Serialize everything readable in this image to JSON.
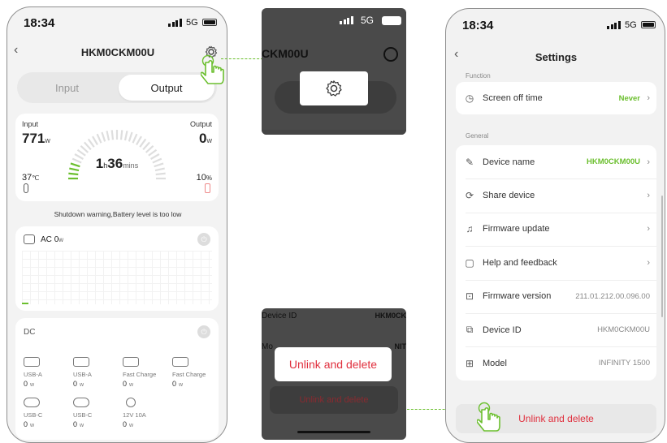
{
  "colors": {
    "accent_green": "#6bbf2e",
    "danger_red": "#e0303e",
    "zoom_bg": "#4a4a4a"
  },
  "phone1": {
    "status": {
      "time": "18:34",
      "network": "5G"
    },
    "header": {
      "title": "HKM0CKM00U",
      "back_icon": "chevron-left-icon",
      "settings_icon": "gear-icon"
    },
    "tabs": {
      "input": "Input",
      "output": "Output"
    },
    "gauge": {
      "input_label": "Input",
      "input_value": "771",
      "input_unit": "w",
      "output_label": "Output",
      "output_value": "0",
      "output_unit": "w",
      "time_h": "1",
      "time_h_unit": "h",
      "time_m": "36",
      "time_m_unit": "mins",
      "temp_value": "37",
      "temp_unit": "℃",
      "battery_value": "10",
      "battery_unit": "%"
    },
    "warning": "Shutdown warning,Battery level is too low",
    "ac": {
      "label": "AC",
      "value": "0",
      "unit": "w"
    },
    "dc": {
      "label": "DC",
      "ports": [
        {
          "name": "USB-A",
          "value": "0",
          "unit": "w"
        },
        {
          "name": "USB-A",
          "value": "0",
          "unit": "w"
        },
        {
          "name": "Fast Charge",
          "value": "0",
          "unit": "w"
        },
        {
          "name": "Fast Charge",
          "value": "0",
          "unit": "w"
        },
        {
          "name": "USB-C",
          "value": "0",
          "unit": "w"
        },
        {
          "name": "USB-C",
          "value": "0",
          "unit": "w"
        },
        {
          "name": "12V 10A",
          "value": "0",
          "unit": "w"
        }
      ]
    }
  },
  "zoom_top": {
    "network": "5G",
    "title": "CKM00U"
  },
  "zoom_bottom": {
    "row1_label": "Device ID",
    "row1_value": "HKM0CK",
    "row2_label": "Mo",
    "row2_value": "NIT",
    "popup": "Unlink and delete",
    "button": "Unlink and delete"
  },
  "settings": {
    "status": {
      "time": "18:34",
      "network": "5G"
    },
    "title": "Settings",
    "function_title": "Function",
    "screen_off": {
      "label": "Screen off time",
      "value": "Never"
    },
    "general_title": "General",
    "rows": [
      {
        "label": "Device name",
        "value": "HKM0CKM00U"
      },
      {
        "label": "Share device",
        "value": ""
      },
      {
        "label": "Firmware update",
        "value": ""
      },
      {
        "label": "Help and feedback",
        "value": ""
      },
      {
        "label": "Firmware version",
        "value": "211.01.212.00.096.00"
      },
      {
        "label": "Device ID",
        "value": "HKM0CKM00U"
      },
      {
        "label": "Model",
        "value": "INFINITY 1500"
      }
    ],
    "unlink": "Unlink and delete"
  }
}
